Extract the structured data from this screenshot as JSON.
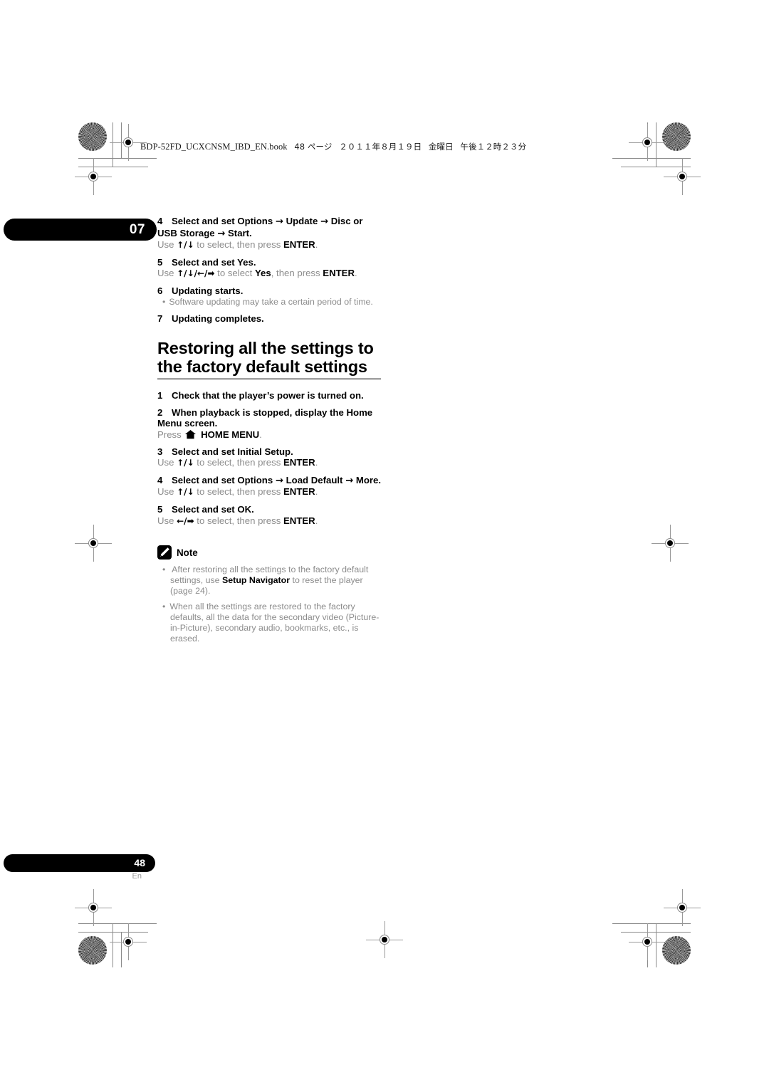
{
  "document": {
    "header_line": "BDP-52FD_UCXCNSM_IBD_EN.book",
    "header_page": "48 ページ",
    "header_date": "２０１１年８月１９日",
    "header_day": "金曜日",
    "header_time": "午後１２時２３分",
    "chapter_number": "07",
    "page_number": "48",
    "language_code": "En"
  },
  "update_steps": {
    "step4": {
      "num": "4",
      "title_part1": "Select and set Options",
      "arrow1": "→",
      "title_part2": "Update",
      "arrow2": "→",
      "title_part3": "Disc or USB Storage",
      "arrow3": "→",
      "title_part4": "Start.",
      "body_use": "Use",
      "body_keys": "↑/↓",
      "body_mid": "to select, then press",
      "body_key_bold": "ENTER",
      "body_end": "."
    },
    "step5": {
      "num": "5",
      "title": "Select and set Yes.",
      "body_use": "Use",
      "body_keys": "↑/↓/←/➡",
      "body_mid": "to select",
      "body_bold1": "Yes",
      "body_mid2": ", then press",
      "body_key_bold": "ENTER",
      "body_end": "."
    },
    "step6": {
      "num": "6",
      "title": "Updating starts.",
      "bullet": "Software updating may take a certain period of time."
    },
    "step7": {
      "num": "7",
      "title": "Updating completes."
    }
  },
  "section": {
    "heading_line1": "Restoring all the settings to",
    "heading_line2": "the factory default settings",
    "step1": {
      "num": "1",
      "title": "Check that the player’s power is turned on."
    },
    "step2": {
      "num": "2",
      "title": "When playback is stopped, display the Home Menu screen.",
      "body_press": "Press",
      "body_bold": "HOME MENU",
      "body_end": "."
    },
    "step3": {
      "num": "3",
      "title": "Select and set Initial Setup.",
      "body_use": "Use",
      "body_keys": "↑/↓",
      "body_mid": "to select, then press",
      "body_key_bold": "ENTER",
      "body_end": "."
    },
    "step4": {
      "num": "4",
      "title_part1": "Select and set Options",
      "arrow1": "→",
      "title_part2": "Load Default",
      "arrow2": "→",
      "title_part3": "More.",
      "body_use": "Use",
      "body_keys": "↑/↓",
      "body_mid": "to select, then press",
      "body_key_bold": "ENTER",
      "body_end": "."
    },
    "step5": {
      "num": "5",
      "title": "Select and set OK.",
      "body_use": "Use",
      "body_keys": "←/➡",
      "body_mid": "to select, then press",
      "body_key_bold": "ENTER",
      "body_end": "."
    }
  },
  "note": {
    "label": "Note",
    "item1_part1": "After restoring all the settings to the factory default settings, use",
    "item1_bold": "Setup Navigator",
    "item1_part2": "to reset the player (page 24).",
    "item2": "When all the settings are restored to the factory defaults, all the data for the secondary video (Picture-in-Picture), secondary audio, bookmarks, etc., is erased."
  },
  "colors": {
    "body_gray": "#8c8c8c",
    "black": "#000000",
    "rule_gray": "#9d9d9d"
  }
}
